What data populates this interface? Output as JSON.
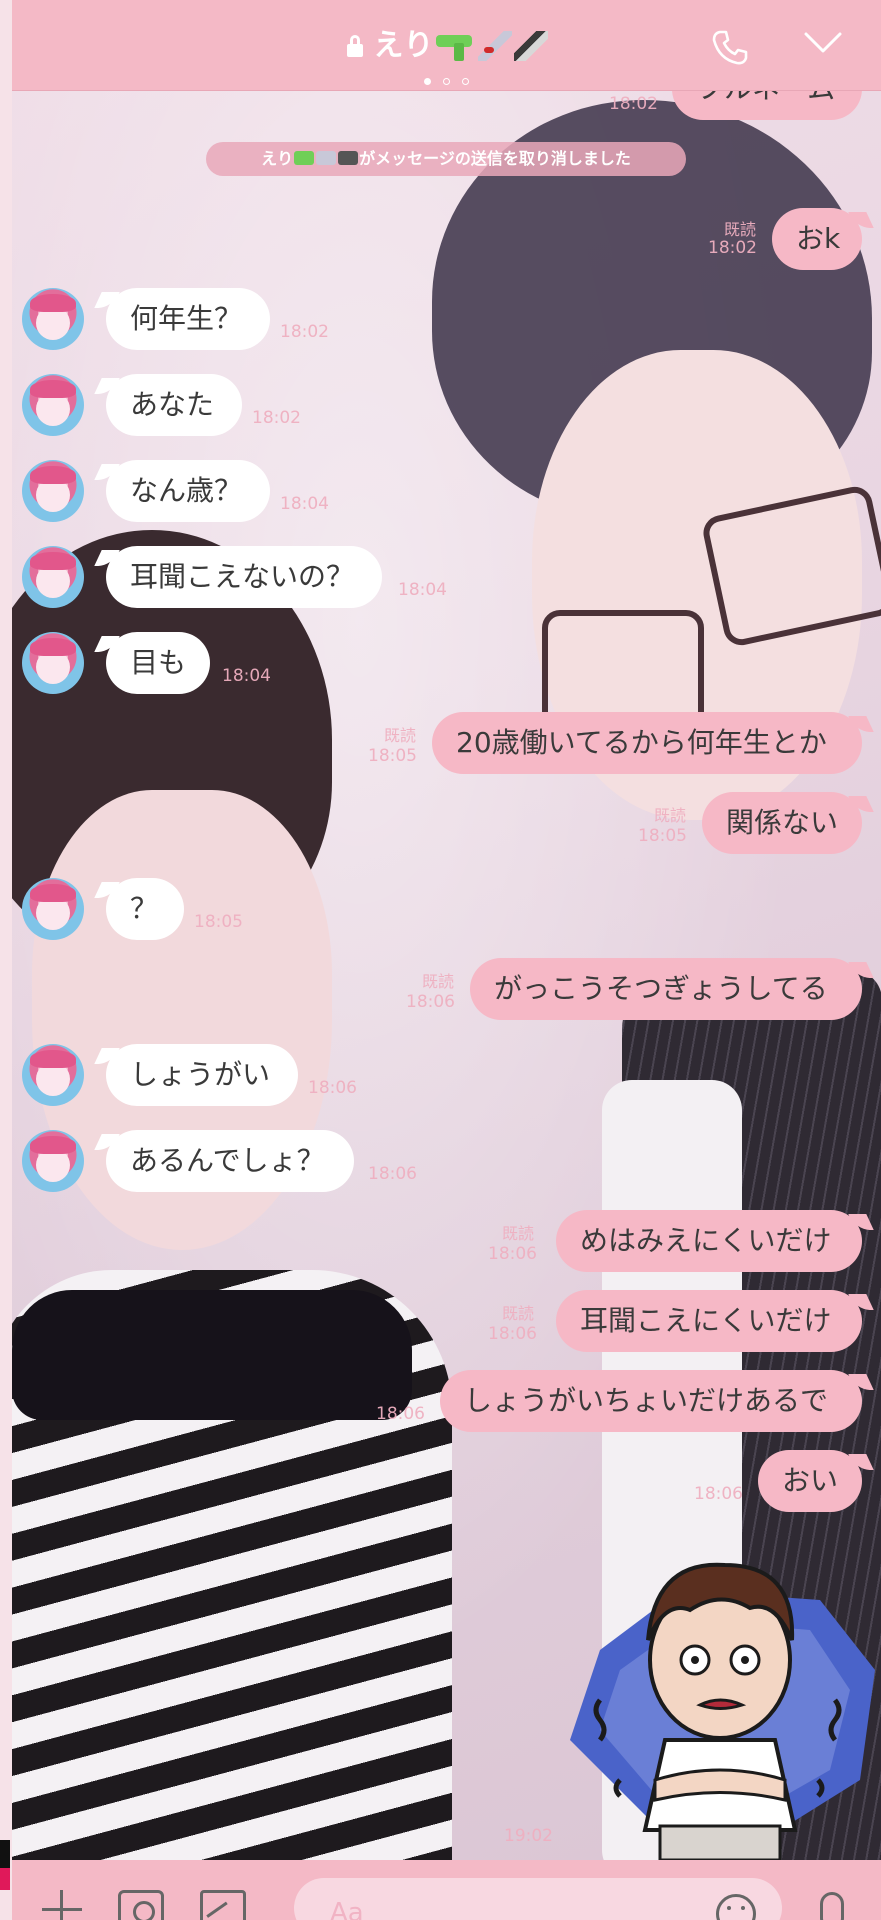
{
  "header": {
    "title": "えり",
    "page_dots": 3,
    "active_dot": 0
  },
  "notices": {
    "unsent_suffix": "がメッセージの送信を取り消しました",
    "sender": "えり"
  },
  "top_partial": {
    "time": "18:02",
    "text": "フルネーム"
  },
  "messages": [
    {
      "dir": "out",
      "text": "おk",
      "read": "既読",
      "time": "18:02"
    },
    {
      "dir": "in",
      "text": "何年生？",
      "time": "18:02"
    },
    {
      "dir": "in",
      "text": "あなた",
      "time": "18:02"
    },
    {
      "dir": "in",
      "text": "なん歳？",
      "time": "18:04"
    },
    {
      "dir": "in",
      "text": "耳聞こえないの？",
      "time": "18:04"
    },
    {
      "dir": "in",
      "text": "目も",
      "time": "18:04"
    },
    {
      "dir": "out",
      "text": "20歳働いてるから何年生とか",
      "read": "既読",
      "time": "18:05"
    },
    {
      "dir": "out",
      "text": "関係ない",
      "read": "既読",
      "time": "18:05"
    },
    {
      "dir": "in",
      "text": "？",
      "time": "18:05"
    },
    {
      "dir": "out",
      "text": "がっこうそつぎょうしてる",
      "read": "既読",
      "time": "18:06"
    },
    {
      "dir": "in",
      "text": "しょうがい",
      "time": "18:06"
    },
    {
      "dir": "in",
      "text": "あるんでしょ？",
      "time": "18:06"
    },
    {
      "dir": "out",
      "text": "めはみえにくいだけ",
      "read": "既読",
      "time": "18:06"
    },
    {
      "dir": "out",
      "text": "耳聞こえにくいだけ",
      "read": "既読",
      "time": "18:06"
    },
    {
      "dir": "out",
      "text": "しょうがいちょいだけあるで",
      "time": "18:06"
    },
    {
      "dir": "out",
      "text": "おい",
      "time": "18:06"
    }
  ],
  "sticker_time": "19:02",
  "footer": {
    "input_placeholder": "Aa"
  },
  "colors": {
    "header_bg": "#f4b9c6",
    "outgoing_bubble": "#f6b8c6",
    "incoming_bubble": "#ffffff",
    "timestamp": "#eeafc0"
  },
  "icons": [
    "lock-icon",
    "phone-icon",
    "chevron-down-icon",
    "plus-icon",
    "camera-icon",
    "image-icon",
    "emoji-icon",
    "mic-icon"
  ]
}
